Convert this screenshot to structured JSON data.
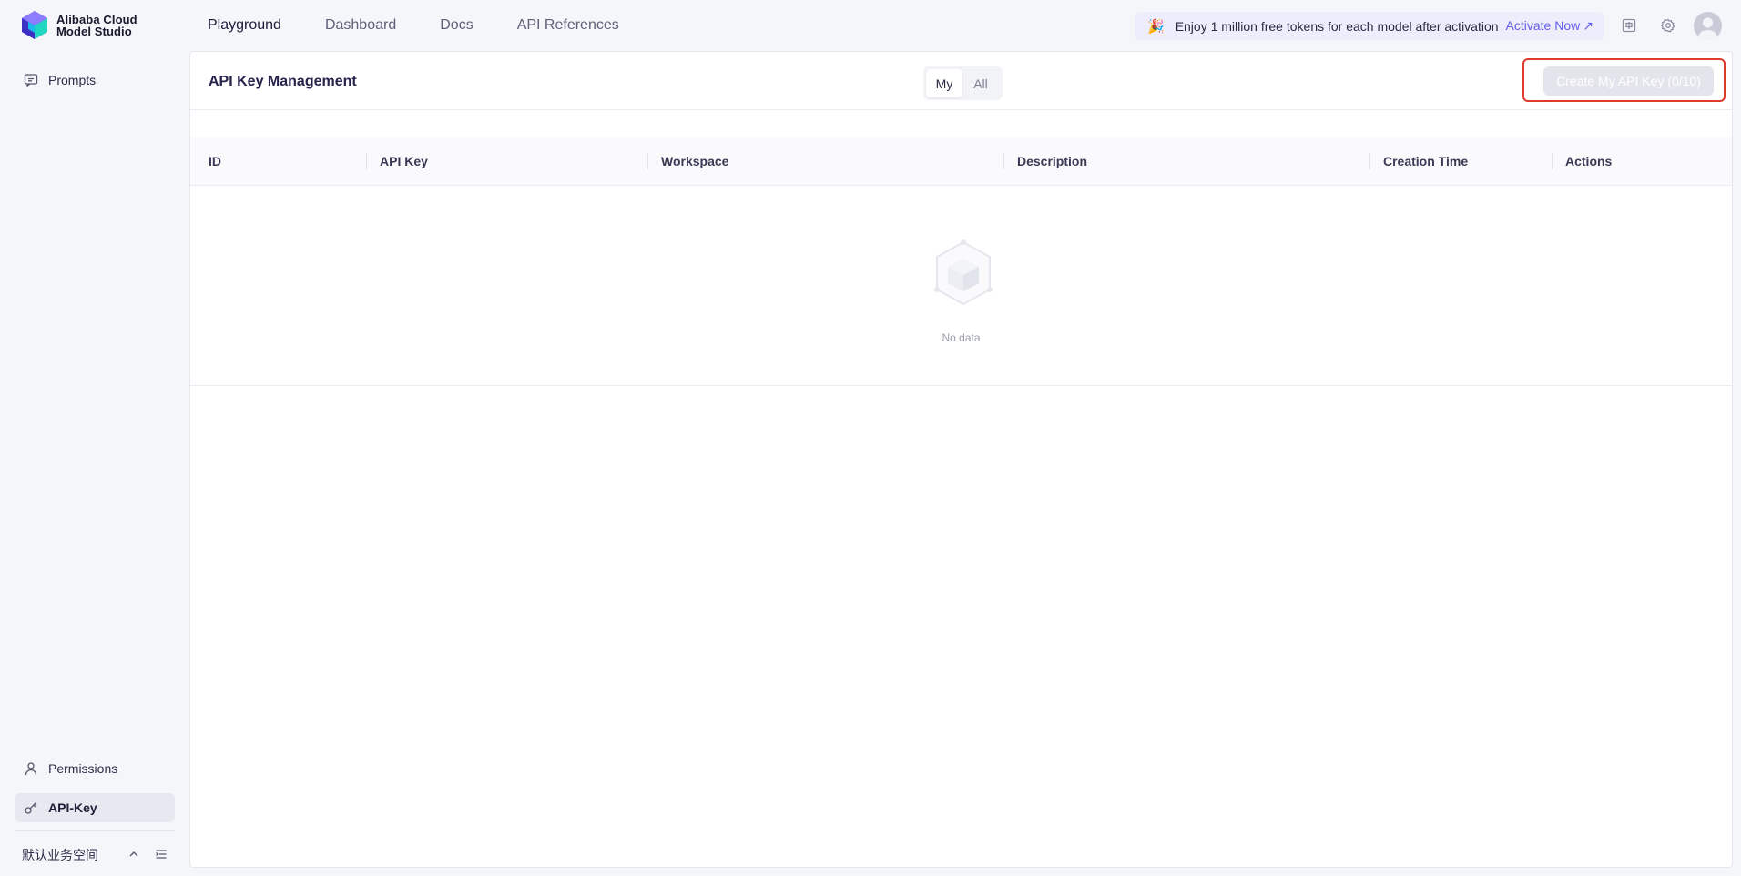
{
  "app": {
    "logo_line1": "Alibaba Cloud",
    "logo_line2": "Model Studio"
  },
  "nav": {
    "items": [
      "Playground",
      "Dashboard",
      "Docs",
      "API References"
    ],
    "active": "Playground"
  },
  "promo": {
    "text": "Enjoy 1 million free tokens for each model after activation",
    "link": "Activate Now",
    "arrow": "↗"
  },
  "sidebar": {
    "top_items": [
      {
        "label": "Prompts",
        "icon": "chat-icon"
      }
    ],
    "bottom_items": [
      {
        "label": "Permissions",
        "icon": "user-icon"
      },
      {
        "label": "API-Key",
        "icon": "key-icon",
        "active": true
      }
    ],
    "workspace": "默认业务空间"
  },
  "main": {
    "title": "API Key Management",
    "filter": {
      "options": [
        "My",
        "All"
      ],
      "selected": "My"
    },
    "create_button": "Create My API Key (0/10)",
    "table": {
      "columns": [
        "ID",
        "API Key",
        "Workspace",
        "Description",
        "Creation Time",
        "Actions"
      ],
      "rows": []
    },
    "empty_text": "No data"
  },
  "colors": {
    "accent": "#615ced",
    "highlight_border": "#e03a2a",
    "background": "#f5f6fa"
  }
}
